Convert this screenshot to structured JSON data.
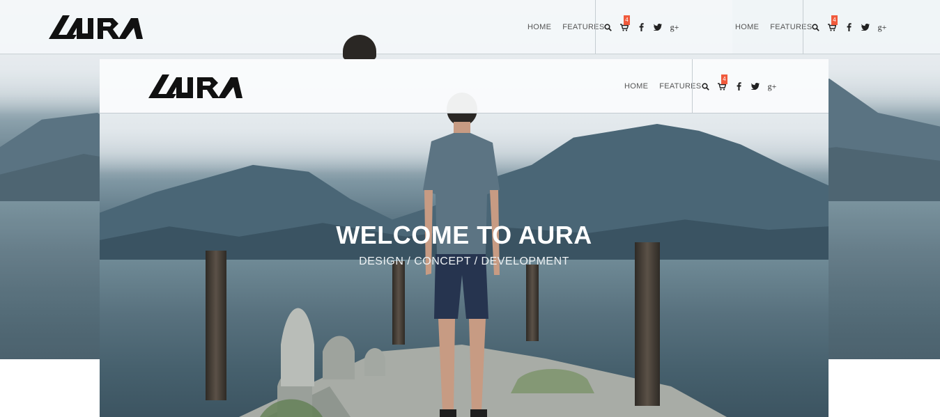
{
  "site": {
    "brand": "AURA",
    "nav": {
      "home": "HOME",
      "features": "FEATURES"
    },
    "cart_count": "4",
    "icons": [
      "search-icon",
      "cart-icon",
      "facebook-icon",
      "twitter-icon",
      "google-plus-icon"
    ]
  },
  "hero": {
    "title": "WELCOME TO AURA",
    "subtitle": "DESIGN / CONCEPT / DEVELOPMENT"
  },
  "colors": {
    "accent": "#f05a3c",
    "nav_text": "#555555",
    "logo": "#111111"
  }
}
